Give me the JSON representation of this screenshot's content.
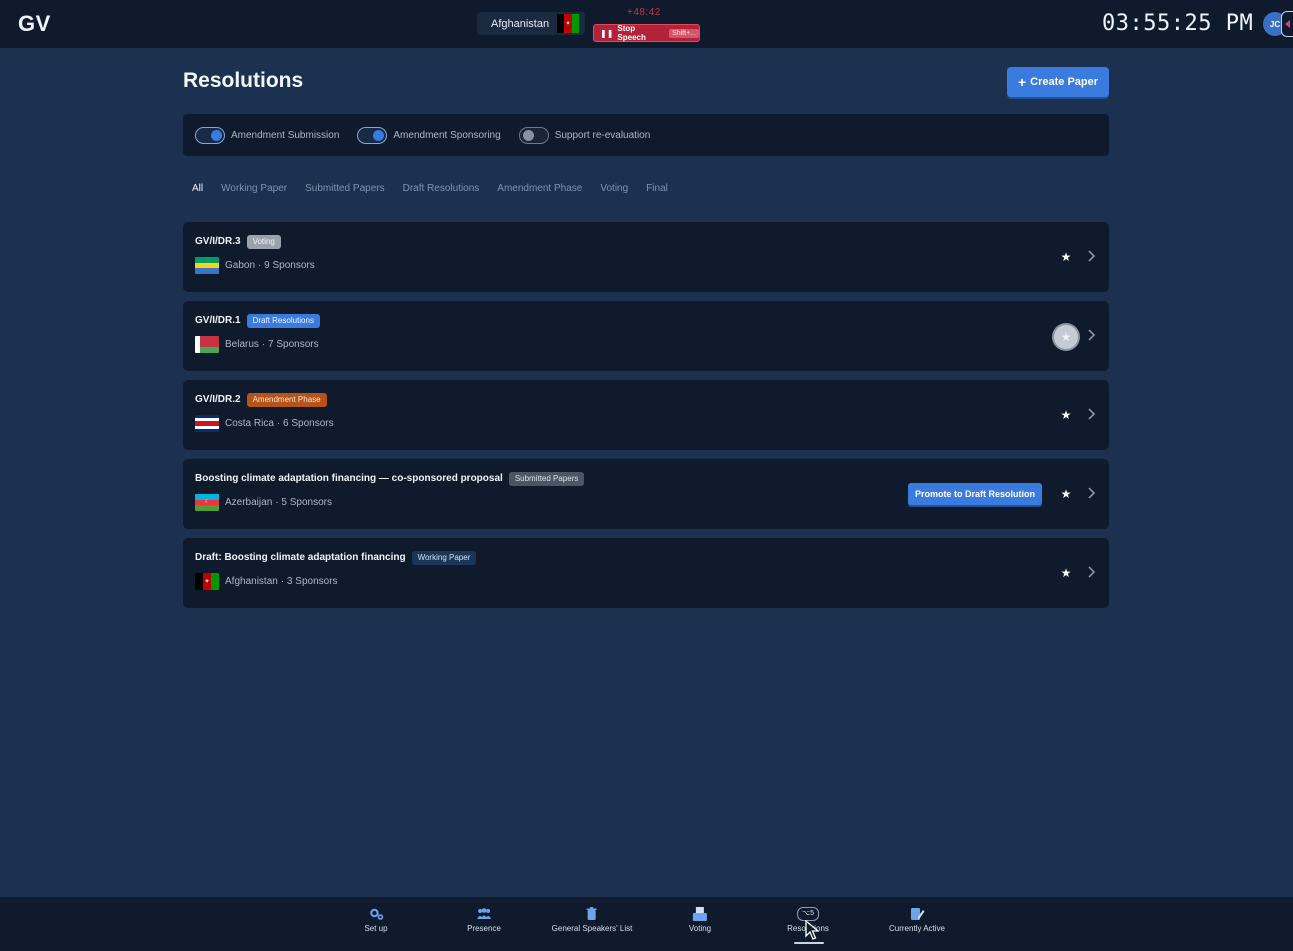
{
  "topbar": {
    "logo": "GV",
    "current_speaker": "Afghanistan",
    "overtime": "+48:42",
    "stop_speech_label": "Stop Speech",
    "stop_speech_shortcut": "Shift+...",
    "clock": "03:55:25 PM",
    "avatar_initials": "JC"
  },
  "header": {
    "title": "Resolutions",
    "create_label": "Create Paper"
  },
  "toggles": [
    {
      "label": "Amendment Submission",
      "on": true
    },
    {
      "label": "Amendment Sponsoring",
      "on": true
    },
    {
      "label": "Support re-evaluation",
      "on": false
    }
  ],
  "filters": [
    "All",
    "Working Paper",
    "Submitted Papers",
    "Draft Resolutions",
    "Amendment Phase",
    "Voting",
    "Final"
  ],
  "active_filter": "All",
  "papers": [
    {
      "title": "GV/I/DR.3",
      "status": "Voting",
      "country": "Gabon",
      "sponsors": "· 9 Sponsors"
    },
    {
      "title": "GV/I/DR.1",
      "status": "Draft Resolutions",
      "country": "Belarus",
      "sponsors": "· 7 Sponsors"
    },
    {
      "title": "GV/I/DR.2",
      "status": "Amendment Phase",
      "country": "Costa Rica",
      "sponsors": "· 6 Sponsors"
    },
    {
      "title": "Boosting climate adaptation financing — co-sponsored proposal",
      "status": "Submitted Papers",
      "country": "Azerbaijan",
      "sponsors": "· 5 Sponsors",
      "action": "Promote to Draft Resolution"
    },
    {
      "title": "Draft: Boosting climate adaptation financing",
      "status": "Working Paper",
      "country": "Afghanistan",
      "sponsors": "· 3 Sponsors"
    }
  ],
  "nav": [
    {
      "label": "Set up",
      "icon": "gears-icon"
    },
    {
      "label": "Presence",
      "icon": "people-icon"
    },
    {
      "label": "General Speakers' List",
      "icon": "trash-icon"
    },
    {
      "label": "Voting",
      "icon": "ballot-box-icon"
    },
    {
      "label": "Resolutions",
      "icon": "shortcut-badge-icon",
      "badge": "⌥5"
    },
    {
      "label": "Currently Active",
      "icon": "edit-document-icon"
    }
  ],
  "colors": {
    "background": "#1c3150",
    "panel": "#0f1b2d",
    "accent": "#3a7be0",
    "stop": "#b3213a",
    "amendment": "#b5541a"
  }
}
